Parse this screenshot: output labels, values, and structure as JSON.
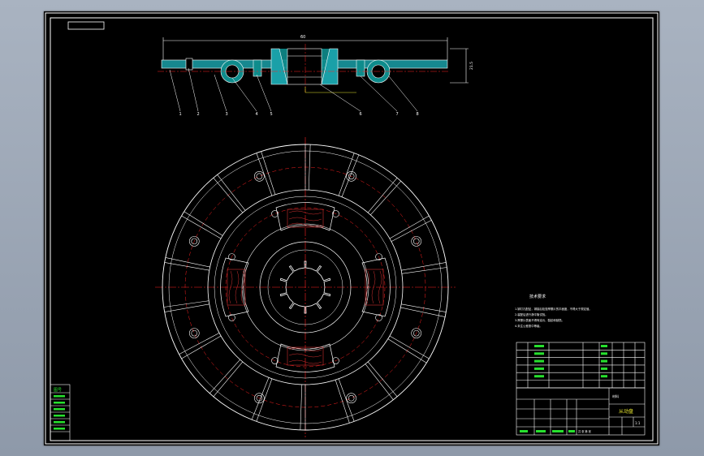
{
  "drawing": {
    "top_dimension": "60",
    "side_dimension": "21.5",
    "balloon_labels": [
      "1",
      "2",
      "3",
      "4",
      "5",
      "6",
      "7",
      "8"
    ],
    "tech_requirements_title": "技术要求",
    "tech_requirements_lines": [
      "1.铆钉孔配钻，铆接后检查摩擦片的平面度，不得大于规定值。",
      "2.装配后进行静平衡试验。",
      "3.摩擦片表面不得有油污、裂纹和缺损。",
      "4.未注公差按中等级。"
    ],
    "title_block": {
      "drawing_title": "从动盘",
      "scale": "1:1",
      "material_label": "材料",
      "sheet_label": "共 张 第 张"
    },
    "left_stamp": {
      "title": "图号"
    }
  },
  "colors": {
    "sheet_bg": "#000000",
    "frame": "#ffffff",
    "centerline": "#ff2020",
    "annotation": "#e9e830",
    "text_green": "#27e02e",
    "hidden": "#d03030"
  }
}
